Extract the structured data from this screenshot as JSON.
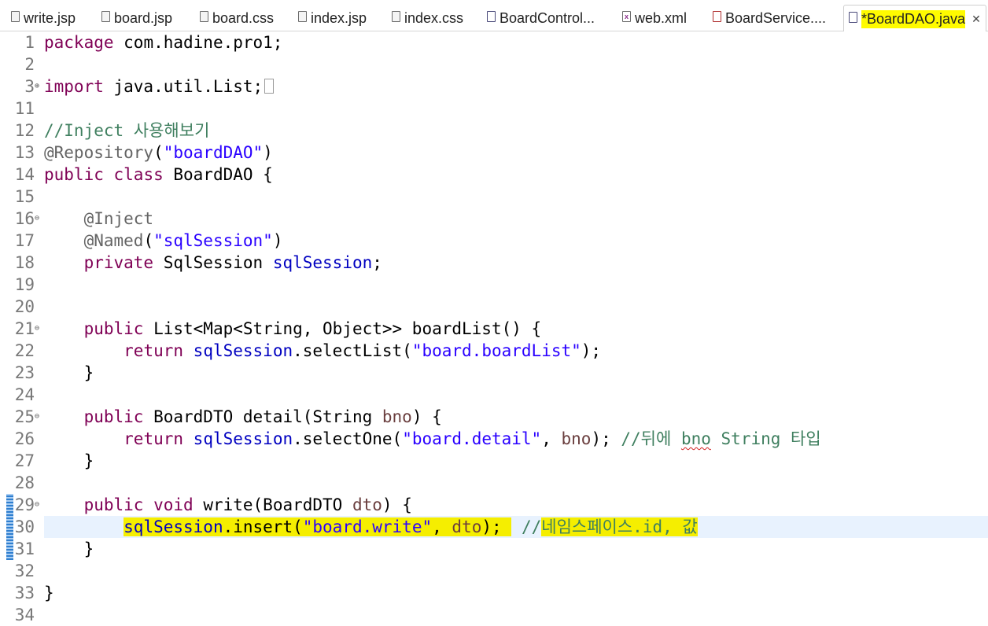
{
  "tabs": [
    {
      "label": "write.jsp",
      "icon": "jsp-file-icon"
    },
    {
      "label": "board.jsp",
      "icon": "jsp-file-icon"
    },
    {
      "label": "board.css",
      "icon": "css-file-icon"
    },
    {
      "label": "index.jsp",
      "icon": "jsp-file-icon"
    },
    {
      "label": "index.css",
      "icon": "css-file-icon"
    },
    {
      "label": "BoardControl...",
      "icon": "java-file-icon"
    },
    {
      "label": "web.xml",
      "icon": "xml-file-icon"
    },
    {
      "label": "BoardService....",
      "icon": "java-file-icon"
    },
    {
      "label": "*BoardDAO.java",
      "icon": "java-file-icon",
      "active": true,
      "close": "✕"
    }
  ],
  "editor": {
    "current_line": 30,
    "lines": [
      {
        "n": "1",
        "text": "package com.hadine.pro1;"
      },
      {
        "n": "2",
        "text": ""
      },
      {
        "n": "3",
        "text": "import java.util.List;"
      },
      {
        "n": "11",
        "text": ""
      },
      {
        "n": "12",
        "text": "//Inject 사용해보기"
      },
      {
        "n": "13",
        "text": "@Repository(\"boardDAO\")"
      },
      {
        "n": "14",
        "text": "public class BoardDAO {"
      },
      {
        "n": "15",
        "text": ""
      },
      {
        "n": "16",
        "text": "    @Inject"
      },
      {
        "n": "17",
        "text": "    @Named(\"sqlSession\")"
      },
      {
        "n": "18",
        "text": "    private SqlSession sqlSession;"
      },
      {
        "n": "19",
        "text": ""
      },
      {
        "n": "20",
        "text": ""
      },
      {
        "n": "21",
        "text": "    public List<Map<String, Object>> boardList() {"
      },
      {
        "n": "22",
        "text": "        return sqlSession.selectList(\"board.boardList\");"
      },
      {
        "n": "23",
        "text": "    }"
      },
      {
        "n": "24",
        "text": ""
      },
      {
        "n": "25",
        "text": "    public BoardDTO detail(String bno) {"
      },
      {
        "n": "26",
        "text": "        return sqlSession.selectOne(\"board.detail\", bno); //뒤에 bno String 타입"
      },
      {
        "n": "27",
        "text": "    }"
      },
      {
        "n": "28",
        "text": ""
      },
      {
        "n": "29",
        "text": "    public void write(BoardDTO dto) {"
      },
      {
        "n": "30",
        "text": "        sqlSession.insert(\"board.write\", dto); //네임스페이스.id, 값"
      },
      {
        "n": "31",
        "text": "    }"
      },
      {
        "n": "32",
        "text": ""
      },
      {
        "n": "33",
        "text": "}"
      },
      {
        "n": "34",
        "text": ""
      }
    ]
  },
  "colors": {
    "keyword": "#7f0055",
    "string": "#2a00ff",
    "comment": "#3f7f5f",
    "field": "#0000c0",
    "highlight": "#f5ee00",
    "current_line": "#e8f2fe"
  }
}
